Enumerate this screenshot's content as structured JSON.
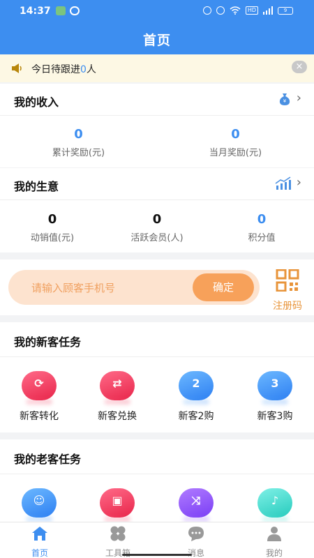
{
  "status_bar": {
    "time": "14:37",
    "hd": "HD",
    "battery": "9"
  },
  "header": {
    "title": "首页"
  },
  "notice": {
    "prefix": "今日待跟进",
    "count": "0",
    "suffix": "人",
    "close": "×"
  },
  "income": {
    "title": "我的收入",
    "stats": [
      {
        "value": "0",
        "label": "累计奖励(元)"
      },
      {
        "value": "0",
        "label": "当月奖励(元)"
      }
    ]
  },
  "business": {
    "title": "我的生意",
    "stats": [
      {
        "value": "0",
        "label": "动销值(元)"
      },
      {
        "value": "0",
        "label": "活跃会员(人)"
      },
      {
        "value": "0",
        "label": "积分值"
      }
    ]
  },
  "search": {
    "placeholder": "请输入顾客手机号",
    "confirm": "确定",
    "register_label": "注册码"
  },
  "new_tasks": {
    "title": "我的新客任务",
    "items": [
      {
        "label": "新客转化",
        "icon": "bag-refresh-icon"
      },
      {
        "label": "新客兑换",
        "icon": "bag-exchange-icon"
      },
      {
        "label": "新客2购",
        "icon": "bag-2-icon",
        "glyph": "2"
      },
      {
        "label": "新客3购",
        "icon": "bag-3-icon",
        "glyph": "3"
      }
    ]
  },
  "old_tasks": {
    "title": "我的老客任务",
    "items": [
      {
        "icon": "user-exchange-icon"
      },
      {
        "icon": "scan-icon"
      },
      {
        "icon": "shuffle-icon"
      },
      {
        "icon": "bell-icon"
      }
    ]
  },
  "tabbar": {
    "items": [
      {
        "label": "首页",
        "icon": "home-icon",
        "active": true
      },
      {
        "label": "工具箱",
        "icon": "toolbox-icon"
      },
      {
        "label": "消息",
        "icon": "message-icon"
      },
      {
        "label": "我的",
        "icon": "profile-icon"
      }
    ]
  },
  "colors": {
    "primary": "#3d8ef0",
    "orange": "#f7a15a",
    "notice_bg": "#fdf8e4"
  }
}
